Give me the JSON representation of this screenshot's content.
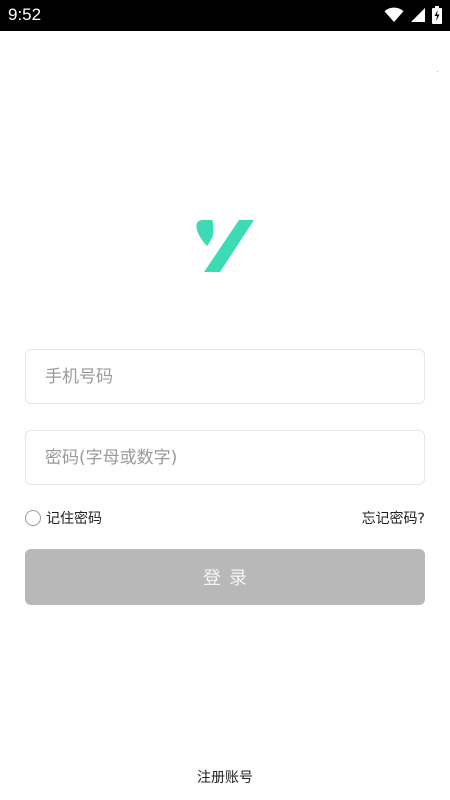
{
  "status_bar": {
    "time": "9:52",
    "icons": [
      "wifi-icon",
      "cellular-signal-icon",
      "battery-charging-icon"
    ]
  },
  "logo": {
    "icon": "brand-y-logo",
    "color": "#3ddbb4"
  },
  "form": {
    "phone_placeholder": "手机号码",
    "phone_value": "",
    "password_placeholder": "密码(字母或数字)",
    "password_value": "",
    "remember_label": "记住密码",
    "remember_checked": false,
    "forgot_label": "忘记密码?",
    "login_label": "登录"
  },
  "footer": {
    "register_label": "注册账号"
  },
  "colors": {
    "button_disabled_bg": "#b8b8b8",
    "accent": "#3ddbb4",
    "status_bar_bg": "#000000"
  }
}
